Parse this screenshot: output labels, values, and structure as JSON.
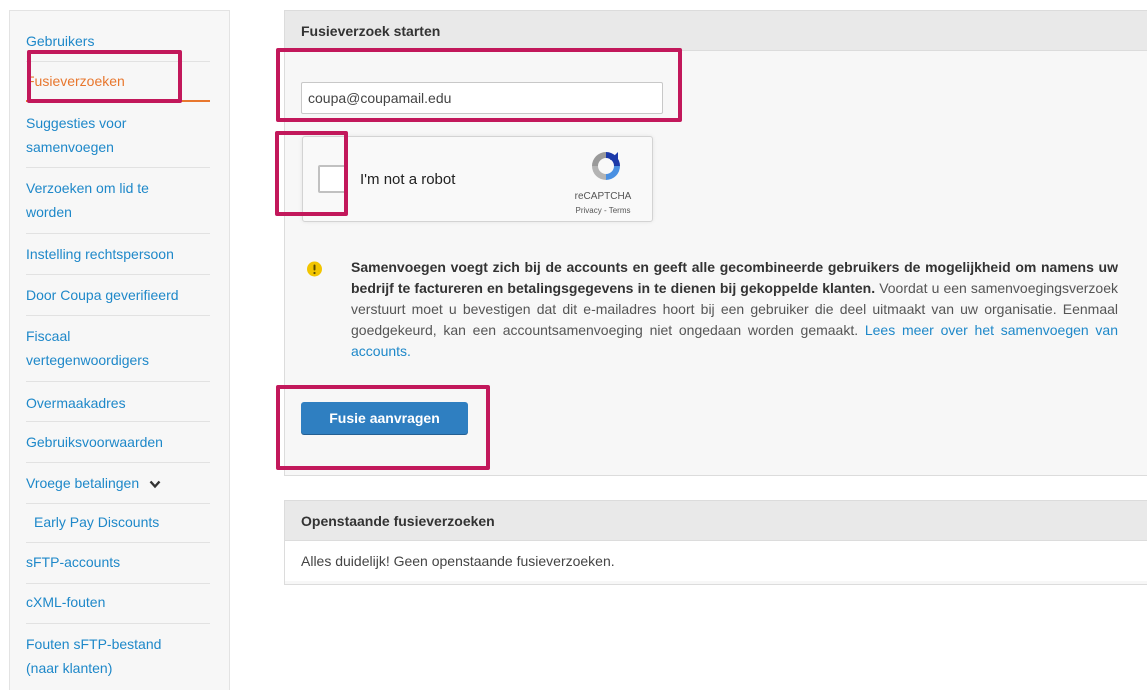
{
  "sidebar": {
    "items": [
      {
        "label": "Gebruikers"
      },
      {
        "label": "Fusieverzoeken"
      },
      {
        "label_line1": "Suggesties voor",
        "label_line2": "samenvoegen"
      },
      {
        "label_line1": "Verzoeken om lid te",
        "label_line2": "worden"
      },
      {
        "label": "Instelling rechtspersoon"
      },
      {
        "label": "Door Coupa geverifieerd"
      },
      {
        "label_line1": "Fiscaal",
        "label_line2": "vertegenwoordigers"
      },
      {
        "label": "Overmaakadres"
      },
      {
        "label": "Gebruiksvoorwaarden"
      },
      {
        "label": "Vroege betalingen"
      },
      {
        "label": "Early Pay Discounts"
      },
      {
        "label": "sFTP-accounts"
      },
      {
        "label": "cXML-fouten"
      },
      {
        "label_line1": "Fouten sFTP-bestand",
        "label_line2": "(naar klanten)"
      }
    ],
    "active_index": 1
  },
  "merge_panel": {
    "title": "Fusieverzoek starten",
    "email_value": "coupa@coupamail.edu",
    "recaptcha": {
      "label": "I'm not a robot",
      "brand": "reCAPTCHA",
      "links": "Privacy - Terms"
    },
    "notice": {
      "bold": "Samenvoegen voegt zich bij de accounts en geeft alle gecombineerde gebruikers de mogelijkheid om namens uw bedrijf te factureren en betalingsgegevens in te dienen bij gekoppelde klanten.",
      "body": " Voordat u een samenvoegingsverzoek verstuurt moet u bevestigen dat dit e-mailadres hoort bij een gebruiker die deel uitmaakt van uw organisatie. Eenmaal goedgekeurd, kan een accountsamenvoeging niet ongedaan worden gemaakt. ",
      "link": "Lees meer over het samenvoegen van accounts."
    },
    "submit_label": "Fusie aanvragen"
  },
  "pending_panel": {
    "title": "Openstaande fusieverzoeken",
    "empty_text": "Alles duidelijk! Geen openstaande fusieverzoeken."
  },
  "colors": {
    "link": "#1e88c9",
    "active": "#e8772e",
    "highlight": "#c2185b",
    "button": "#2f7fc1"
  }
}
